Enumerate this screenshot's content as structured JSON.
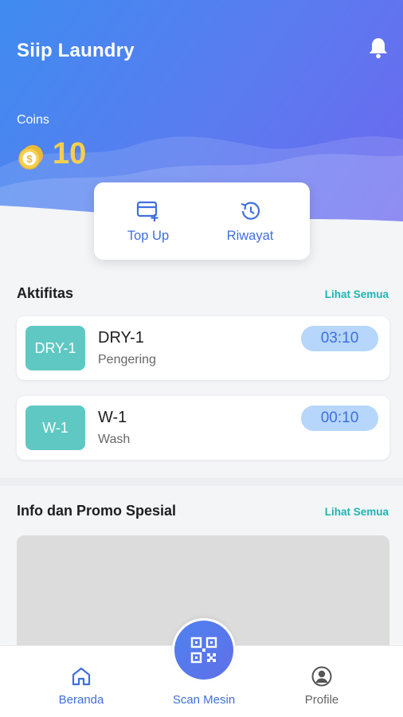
{
  "app": {
    "title": "Siip Laundry"
  },
  "header": {
    "notification_icon": "bell-icon"
  },
  "coins": {
    "label": "Coins",
    "value": "10",
    "icon": "coin-icon"
  },
  "quick_actions": [
    {
      "label": "Top Up",
      "icon": "card-add-icon"
    },
    {
      "label": "Riwayat",
      "icon": "history-icon"
    }
  ],
  "activity": {
    "title": "Aktifitas",
    "see_all": "Lihat Semua",
    "items": [
      {
        "badge": "DRY-1",
        "name": "DRY-1",
        "type": "Pengering",
        "timer": "03:10"
      },
      {
        "badge": "W-1",
        "name": "W-1",
        "type": "Wash",
        "timer": "00:10"
      }
    ]
  },
  "promo": {
    "title": "Info dan Promo Spesial",
    "see_all": "Lihat Semua"
  },
  "nav": {
    "home": "Beranda",
    "scan": "Scan Mesin",
    "profile": "Profile"
  },
  "colors": {
    "primary": "#3f6fe0",
    "accent_teal": "#1fb5b0",
    "badge": "#5fc8c3",
    "coin_gold": "#f7cf4a",
    "timer_bg": "#b6d6fb"
  }
}
